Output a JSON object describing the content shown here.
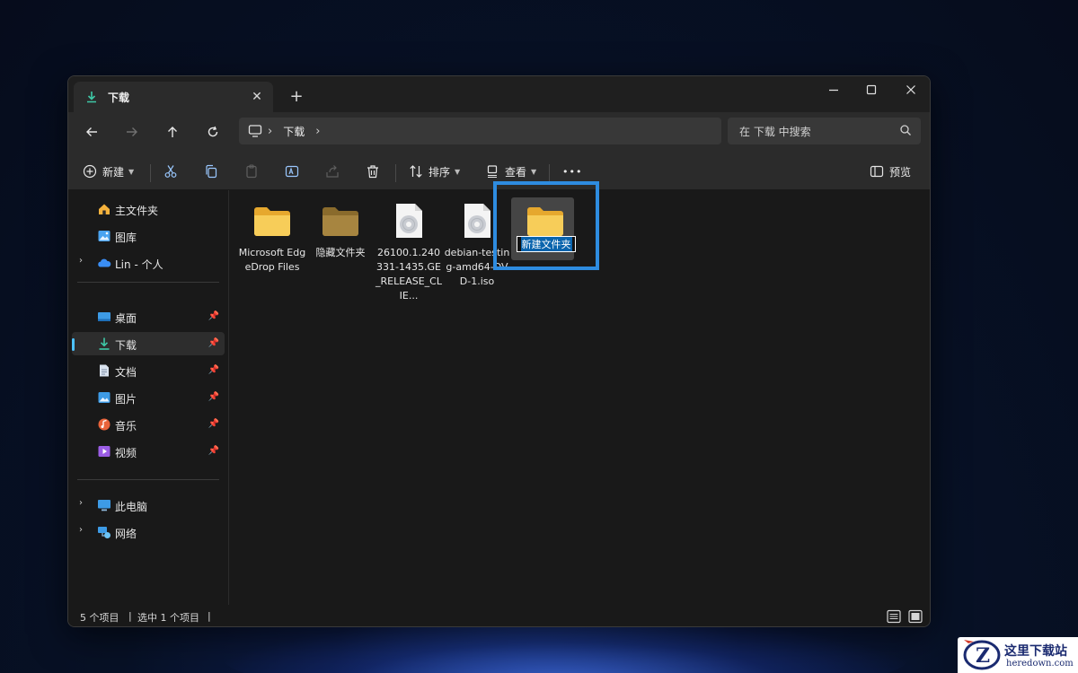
{
  "window": {
    "tab_label": "下载",
    "new_tab": "+",
    "tab_close": "✕"
  },
  "address": {
    "crumbs": [
      "下载"
    ],
    "search_placeholder": "在 下载 中搜索"
  },
  "toolbar": {
    "new_label": "新建",
    "sort_label": "排序",
    "view_label": "查看",
    "more_label": "•••",
    "preview_label": "预览"
  },
  "sidebar": {
    "top_items": [
      {
        "label": "主文件夹",
        "icon": "home-icon"
      },
      {
        "label": "图库",
        "icon": "gallery-icon"
      },
      {
        "label": "Lin - 个人",
        "icon": "onedrive-cloud-icon"
      }
    ],
    "quick_access": [
      {
        "label": "桌面",
        "icon": "desktop-icon"
      },
      {
        "label": "下载",
        "icon": "download-icon",
        "active": true
      },
      {
        "label": "文档",
        "icon": "document-icon"
      },
      {
        "label": "图片",
        "icon": "pictures-icon"
      },
      {
        "label": "音乐",
        "icon": "music-icon"
      },
      {
        "label": "视频",
        "icon": "video-icon"
      }
    ],
    "bottom_items": [
      {
        "label": "此电脑",
        "icon": "this-pc-icon"
      },
      {
        "label": "网络",
        "icon": "network-icon"
      }
    ]
  },
  "files": [
    {
      "name": "Microsoft EdgeDrop Files",
      "type": "folder"
    },
    {
      "name": "隐藏文件夹",
      "type": "hidden-folder"
    },
    {
      "name": "26100.1.240331-1435.GE_RELEASE_CLIE...",
      "type": "iso"
    },
    {
      "name": "debian-testing-amd64-DVD-1.iso",
      "type": "iso"
    },
    {
      "name": "新建文件夹",
      "type": "folder",
      "selected": true,
      "renaming": true
    }
  ],
  "status": {
    "item_count": "5 个项目",
    "selected_count": "选中 1 个项目",
    "sep": "|"
  },
  "watermark": {
    "title": "这里下载站",
    "subtitle": "heredown.com"
  },
  "colors": {
    "accent": "#4cc2ff",
    "highlight": "#2e8ce0",
    "folder": "#f5c446",
    "selection": "#0a64ad"
  }
}
